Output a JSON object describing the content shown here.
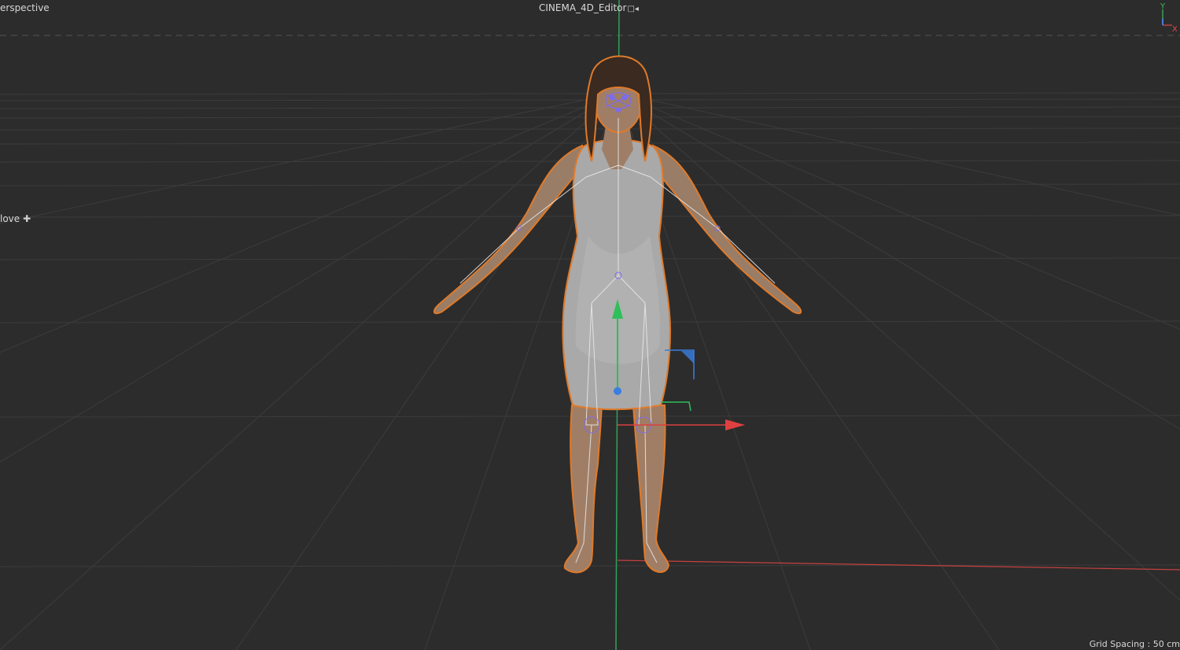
{
  "viewport": {
    "view_name": "erspective",
    "camera": "CINEMA_4D_Editor",
    "camera_icon": "camera-icon",
    "tool": "love",
    "tool_icon": "move-icon",
    "grid_spacing": "Grid Spacing : 50 cm"
  },
  "axis_gizmo": {
    "y_label": "Y",
    "x_label": "X",
    "colors": {
      "x": "#e04848",
      "y": "#3cbf5c",
      "z": "#4a7dd6"
    }
  },
  "colors": {
    "background": "#2c2c2c",
    "grid": "#3a3a3a",
    "selection_outline": "#e07a2a",
    "skin": "#b08a6a",
    "dress": "#a8a8a8",
    "joint": "#7b6cf0"
  }
}
